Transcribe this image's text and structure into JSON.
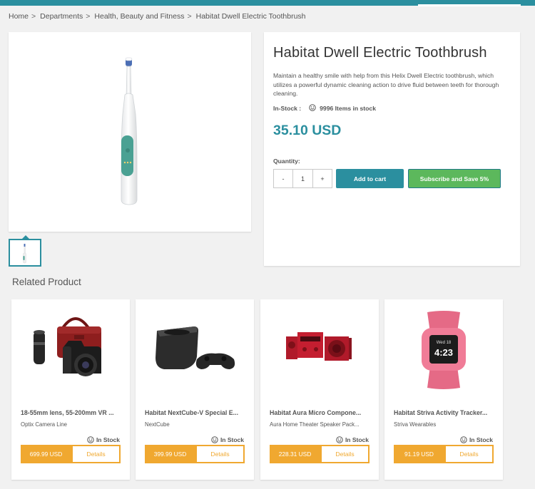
{
  "breadcrumb": [
    "Home",
    "Departments",
    "Health, Beauty and Fitness",
    "Habitat Dwell Electric Toothbrush"
  ],
  "product": {
    "title": "Habitat Dwell Electric Toothbrush",
    "description": "Maintain a healthy smile with help from this Helix Dwell Electric toothbrush, which utilizes a powerful dynamic cleaning action to drive fluid between teeth for thorough cleaning.",
    "stock_label": "In-Stock :",
    "stock_count": "9996 Items in stock",
    "price": "35.10 USD",
    "quantity_label": "Quantity:",
    "quantity_minus": "-",
    "quantity_value": "1",
    "quantity_plus": "+",
    "add_to_cart": "Add to cart",
    "subscribe": "Subscribe and Save 5%"
  },
  "related": {
    "title": "Related Product",
    "items": [
      {
        "name": "18-55mm lens, 55-200mm VR ...",
        "brand": "Optix Camera Line",
        "stock": "In Stock",
        "price": "699.99 USD",
        "details": "Details",
        "image_icon": "camera-icon"
      },
      {
        "name": "Habitat NextCube-V Special E...",
        "brand": "NextCube",
        "stock": "In Stock",
        "price": "399.99 USD",
        "details": "Details",
        "image_icon": "game-console-icon"
      },
      {
        "name": "Habitat Aura Micro Compone...",
        "brand": "Aura Home Theater Speaker Pack...",
        "stock": "In Stock",
        "price": "228.31 USD",
        "details": "Details",
        "image_icon": "speaker-system-icon"
      },
      {
        "name": "Habitat Striva Activity Tracker...",
        "brand": "Striva Wearables",
        "stock": "In Stock",
        "price": "91.19 USD",
        "details": "Details",
        "image_icon": "activity-tracker-icon"
      }
    ]
  },
  "tracker_screen": {
    "line1": "Wed 18",
    "line2": "4:23"
  },
  "colors": {
    "accent": "#2b8f9f",
    "price_orange": "#f0a830",
    "subscribe_green": "#5cb85c"
  }
}
